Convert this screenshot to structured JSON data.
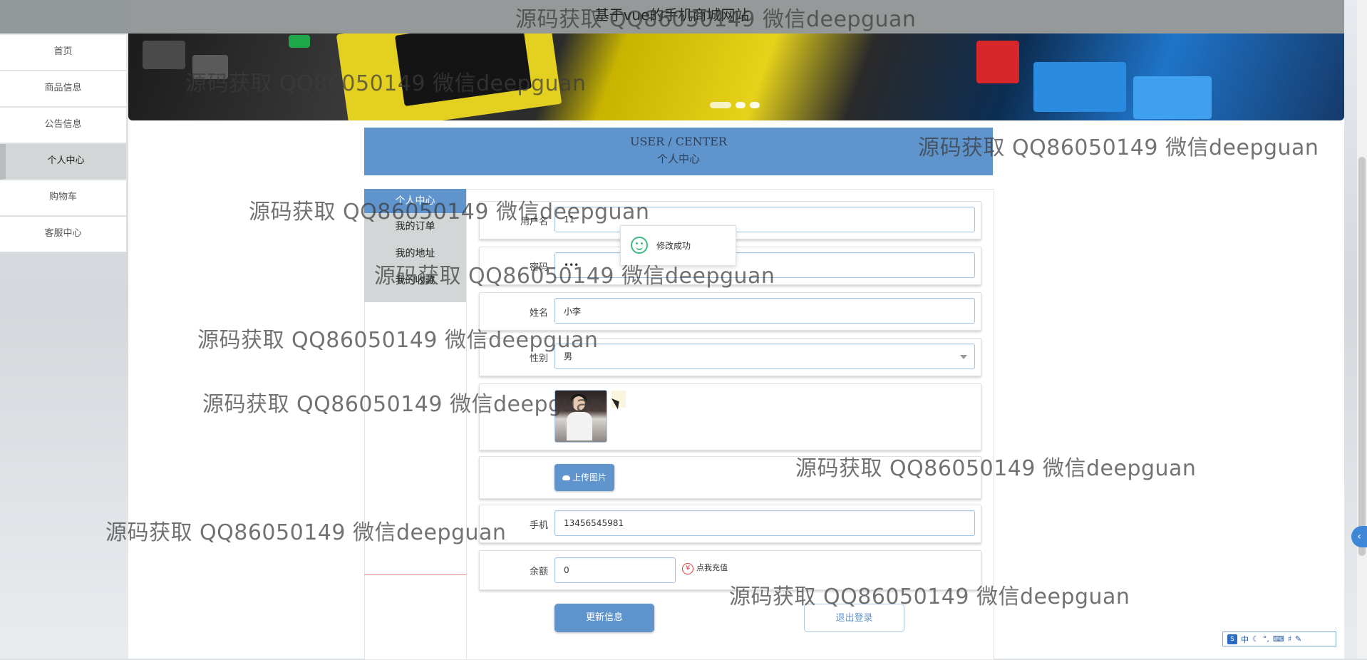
{
  "top_title": "基于vue的手机商城网站",
  "nav": [
    {
      "label": "首页"
    },
    {
      "label": "商品信息"
    },
    {
      "label": "公告信息"
    },
    {
      "label": "个人中心"
    },
    {
      "label": "购物车"
    },
    {
      "label": "客服中心"
    }
  ],
  "user_center": {
    "title_en": "USER / CENTER",
    "title_cn": "个人中心",
    "menu": [
      {
        "label": "个人中心"
      },
      {
        "label": "我的订单"
      },
      {
        "label": "我的地址"
      },
      {
        "label": "我的收藏"
      }
    ]
  },
  "form": {
    "username": {
      "label": "用户名",
      "value": "11"
    },
    "password": {
      "label": "密码",
      "value": "•••"
    },
    "name": {
      "label": "姓名",
      "value": "小李"
    },
    "gender": {
      "label": "性别",
      "value": "男"
    },
    "upload_button": "上传图片",
    "phone": {
      "label": "手机",
      "value": "13456545981"
    },
    "balance": {
      "label": "余额",
      "value": "0"
    },
    "recharge_link": "点我充值",
    "yen_icon": "¥",
    "update_button": "更新信息",
    "logout_button": "退出登录"
  },
  "toast": {
    "message": "修改成功"
  },
  "ime": {
    "logo": "S",
    "label": "中"
  },
  "side_tab_icon": "‹",
  "watermarks": [
    "源码获取 QQ86050149 微信deepguan",
    "源码获取 QQ86050149 微信deepguan",
    "源码获取 QQ86050149 微信deepguan",
    "源码获取 QQ86050149 微信deepguan",
    "源码获取 QQ86050149 微信deepguan",
    "源码获取 QQ86050149 微信deepguan",
    "源码获取 QQ86050149 微信deepguan",
    "源码获取 QQ86050149 微信deepguan",
    "源码获取 QQ86050149 微信deepguan",
    "源码获取 QQ86050149 微信deepguan"
  ],
  "colors": {
    "primary": "#5f95cc",
    "success": "#3fb882",
    "danger": "#e23b3b"
  }
}
